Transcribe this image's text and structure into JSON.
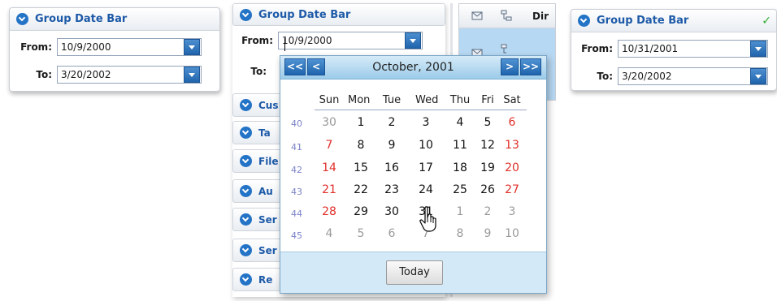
{
  "panel1": {
    "title": "Group Date Bar",
    "from_label": "From:",
    "from_value": "10/9/2000",
    "to_label": "To:",
    "to_value": "3/20/2002"
  },
  "panel2": {
    "title": "Group Date Bar",
    "from_label": "From:",
    "from_value": "10/9/2000",
    "to_label": "To:",
    "sections": [
      "Cus",
      "Ta",
      "File",
      "Au",
      "Ser",
      "Ser",
      "Re"
    ]
  },
  "strip": {
    "header_label": "Dir"
  },
  "panel3": {
    "title": "Group Date Bar",
    "from_label": "From:",
    "from_value": "10/31/2001",
    "to_label": "To:",
    "to_value": "3/20/2002",
    "status": "✓"
  },
  "calendar": {
    "month_title": "October, 2001",
    "nav": {
      "prev_year": "<<",
      "prev_month": "<",
      "next_month": ">",
      "next_year": ">>"
    },
    "days_of_week": [
      "Sun",
      "Mon",
      "Tue",
      "Wed",
      "Thu",
      "Fri",
      "Sat"
    ],
    "weeks": [
      {
        "num": "40",
        "days": [
          "30",
          "1",
          "2",
          "3",
          "4",
          "5",
          "6"
        ]
      },
      {
        "num": "41",
        "days": [
          "7",
          "8",
          "9",
          "10",
          "11",
          "12",
          "13"
        ]
      },
      {
        "num": "42",
        "days": [
          "14",
          "15",
          "16",
          "17",
          "18",
          "19",
          "20"
        ]
      },
      {
        "num": "43",
        "days": [
          "21",
          "22",
          "23",
          "24",
          "25",
          "26",
          "27"
        ]
      },
      {
        "num": "44",
        "days": [
          "28",
          "29",
          "30",
          "31",
          "1",
          "2",
          "3"
        ]
      },
      {
        "num": "45",
        "days": [
          "4",
          "5",
          "6",
          "7",
          "8",
          "9",
          "10"
        ]
      }
    ],
    "today_label": "Today"
  },
  "colors": {
    "accent": "#2373c6",
    "title_text": "#1d5aa8",
    "weekend": "#e0302b",
    "week_number": "#7b83c8",
    "header_blue": "#9ccbe9",
    "check": "#2fae2f"
  }
}
